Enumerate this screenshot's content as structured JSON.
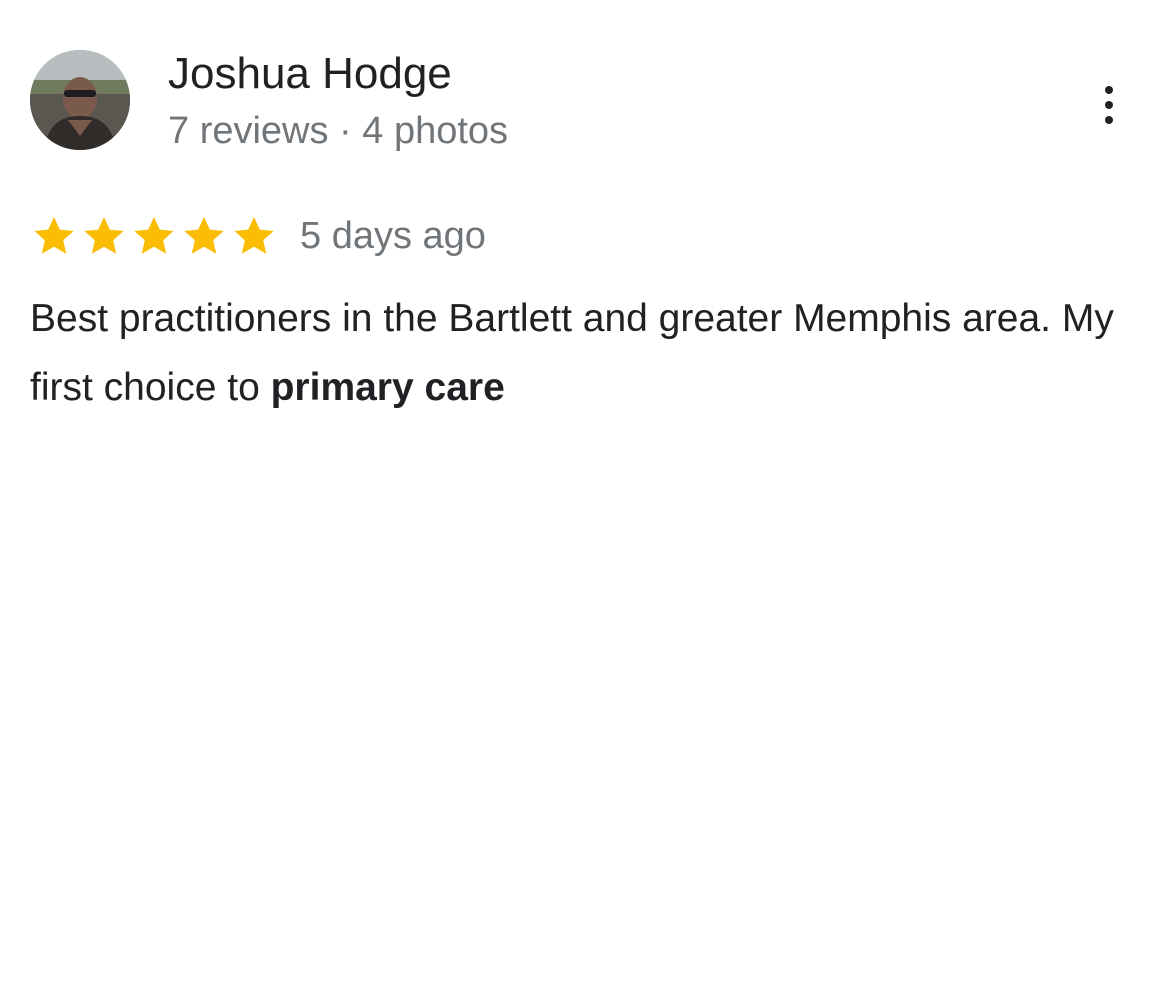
{
  "reviewer": {
    "name": "Joshua Hodge",
    "meta": "7 reviews · 4 photos",
    "avatar_icon": "profile-photo"
  },
  "menu": {
    "icon": "more-vert-icon"
  },
  "review": {
    "rating": 5,
    "rating_max": 5,
    "star_color": "#fbbc04",
    "date": "5 days ago",
    "text_plain": "Best practitioners in the Bartlett and greater Memphis area. My first choice to",
    "text_bold": "primary care"
  }
}
